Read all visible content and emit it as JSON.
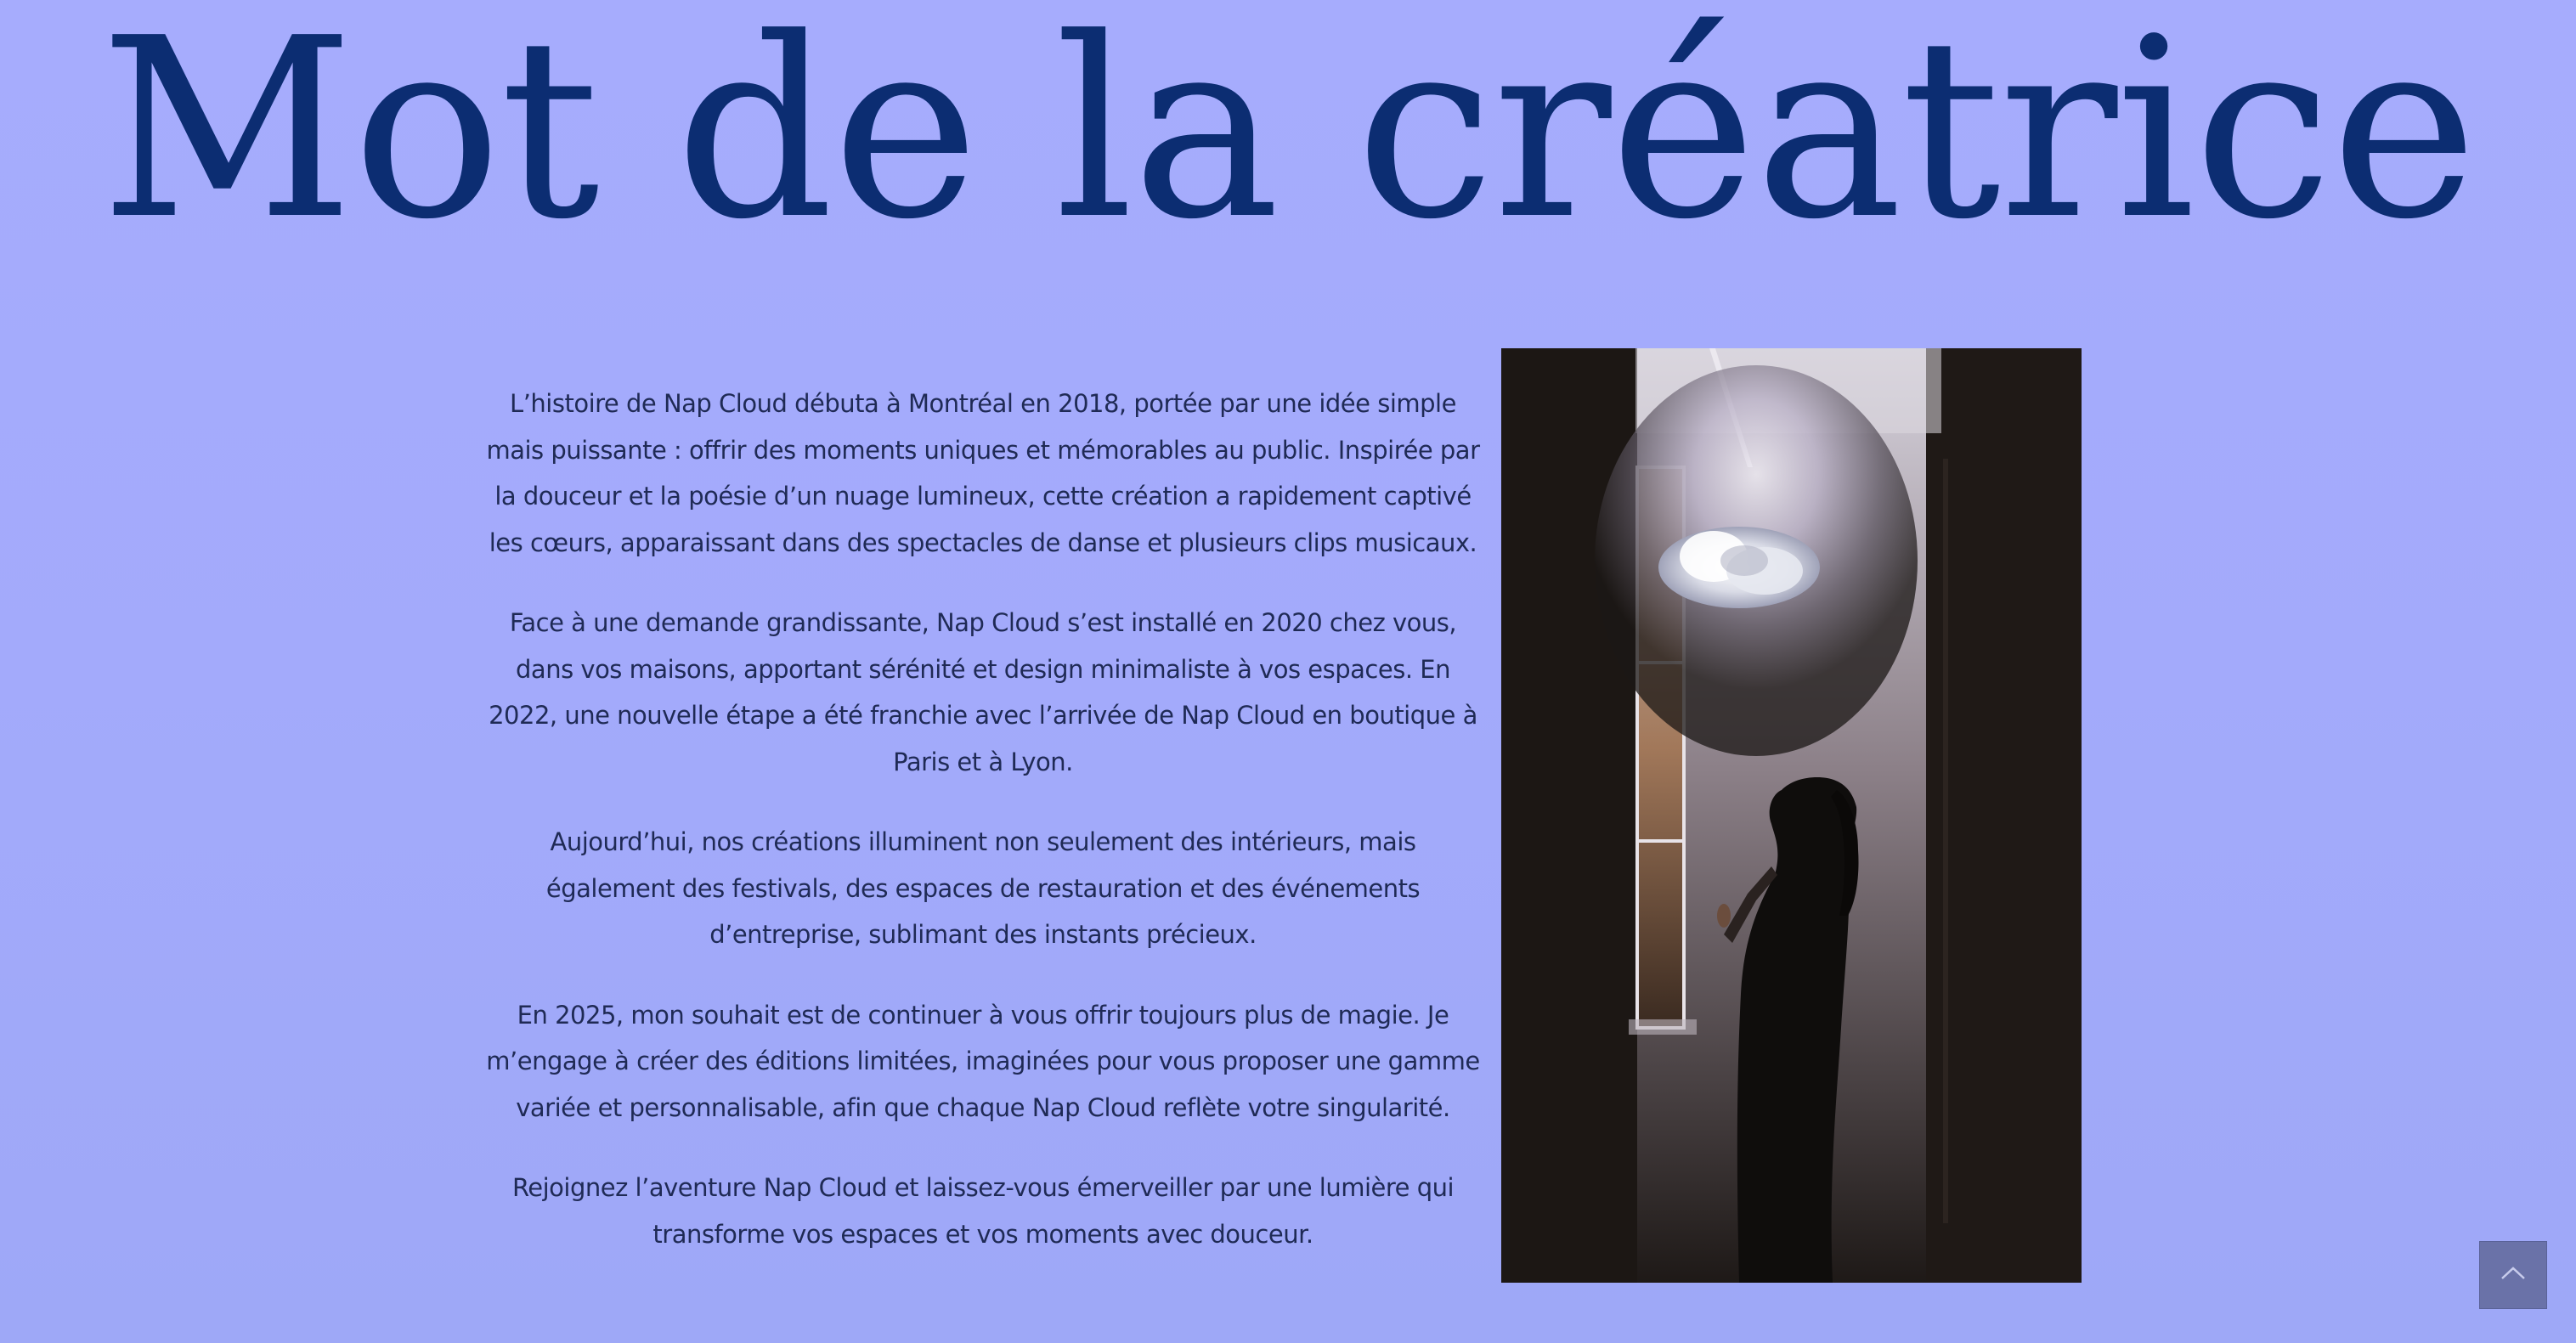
{
  "section": {
    "title": "Mot de la créatrice",
    "paragraphs": [
      "L’histoire de Nap Cloud débuta à Montréal en 2018, portée par une idée simple mais puissante : offrir des moments uniques et mémorables au public. Inspirée par la douceur et la poésie d’un nuage lumineux, cette création a rapidement captivé les cœurs, apparaissant dans des spectacles de danse et plusieurs clips musicaux.",
      "Face à une demande grandissante, Nap Cloud s’est installé en 2020 chez vous, dans vos maisons, apportant sérénité et design minimaliste à vos espaces. En 2022, une nouvelle étape a été franchie avec l’arrivée de Nap Cloud en boutique à Paris et à Lyon.",
      "Aujourd’hui, nos créations illuminent non seulement des intérieurs, mais également des festivals, des espaces de restauration et des événements d’entreprise, sublimant des instants précieux.",
      "En 2025, mon souhait est de continuer à vous offrir toujours plus de magie. Je m’engage à créer des éditions limitées, imaginées pour vous proposer une gamme variée et personnalisable, afin que chaque Nap Cloud reflète votre singularité.",
      "Rejoignez l’aventure Nap Cloud et laissez-vous émerveiller par une lumière qui transforme vos espaces et vos moments avec douceur."
    ]
  },
  "scroll_top": {
    "icon": "chevron-up-icon"
  },
  "colors": {
    "background": "#a6acfd",
    "title": "#0c2d72",
    "body_text": "#1f2a55",
    "scroll_button": "#6a72a8"
  }
}
